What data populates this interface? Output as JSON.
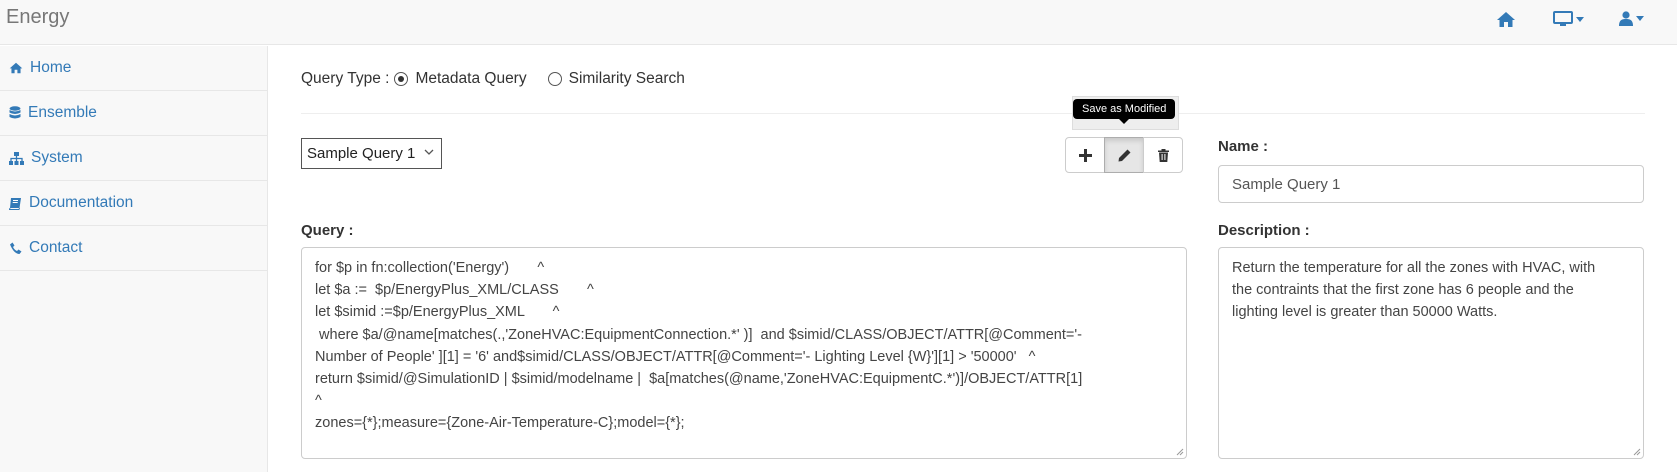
{
  "app": {
    "title": "Energy"
  },
  "topnav": {
    "icons": [
      {
        "name": "home-icon"
      },
      {
        "name": "monitor-icon"
      },
      {
        "name": "user-icon"
      }
    ]
  },
  "sidebar": {
    "items": [
      {
        "label": "Home",
        "icon": "home-icon"
      },
      {
        "label": "Ensemble",
        "icon": "database-icon"
      },
      {
        "label": "System",
        "icon": "sitemap-icon"
      },
      {
        "label": "Documentation",
        "icon": "book-icon"
      },
      {
        "label": "Contact",
        "icon": "phone-icon"
      }
    ]
  },
  "query_type": {
    "label": "Query Type :",
    "options": [
      {
        "label": "Metadata Query",
        "checked": true
      },
      {
        "label": "Similarity Search",
        "checked": false
      }
    ]
  },
  "sample_select": {
    "value": "Sample Query 1"
  },
  "toolbar": {
    "tooltip": "Save as Modified",
    "buttons": [
      {
        "name": "add-button",
        "icon": "plus-icon"
      },
      {
        "name": "edit-button",
        "icon": "pencil-icon",
        "active": true
      },
      {
        "name": "delete-button",
        "icon": "trash-icon"
      }
    ]
  },
  "query": {
    "label": "Query :",
    "text": "for $p in fn:collection('Energy')       ^\nlet $a :=  $p/EnergyPlus_XML/CLASS       ^\nlet $simid :=$p/EnergyPlus_XML       ^\n where $a/@name[matches(.,'ZoneHVAC:EquipmentConnection.*' )]  and $simid/CLASS/OBJECT/ATTR[@Comment='-\nNumber of People' ][1] = '6' and$simid/CLASS/OBJECT/ATTR[@Comment='- Lighting Level {W}'][1] > '50000'   ^\nreturn $simid/@SimulationID | $simid/modelname |  $a[matches(@name,'ZoneHVAC:EquipmentC.*')]/OBJECT/ATTR[1]\n^\nzones={*};measure={Zone-Air-Temperature-C};model={*};"
  },
  "name": {
    "label": "Name :",
    "value": "Sample Query 1"
  },
  "description": {
    "label": "Description :",
    "text": "Return the temperature for all the zones with HVAC, with\nthe contraints that the first zone has 6 people and the\nlighting level is greater than 50000 Watts."
  },
  "colors": {
    "link": "#337ab7",
    "navbar_bg": "#f8f8f8",
    "tooltip_bg": "#000000"
  }
}
